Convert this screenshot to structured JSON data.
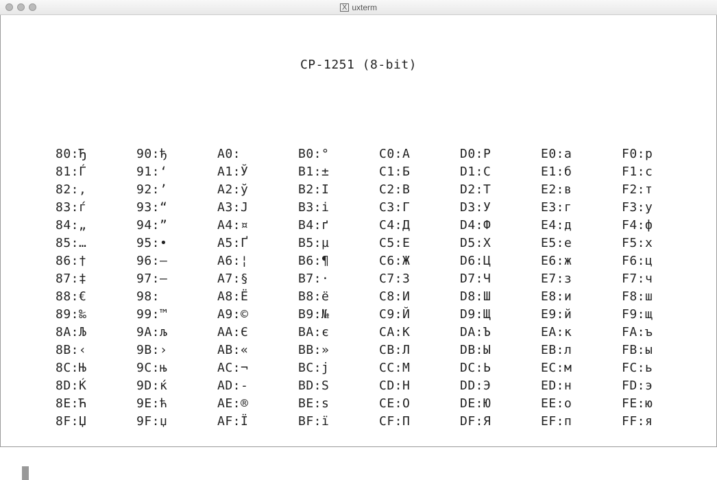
{
  "window": {
    "title": "uxterm"
  },
  "terminal": {
    "title": "CP-1251 (8-bit)",
    "columns": [
      {
        "start": "80",
        "entries": [
          {
            "code": "80",
            "char": "Ђ"
          },
          {
            "code": "81",
            "char": "Ѓ"
          },
          {
            "code": "82",
            "char": "‚"
          },
          {
            "code": "83",
            "char": "ѓ"
          },
          {
            "code": "84",
            "char": "„"
          },
          {
            "code": "85",
            "char": "…"
          },
          {
            "code": "86",
            "char": "†"
          },
          {
            "code": "87",
            "char": "‡"
          },
          {
            "code": "88",
            "char": "€"
          },
          {
            "code": "89",
            "char": "‰"
          },
          {
            "code": "8A",
            "char": "Љ"
          },
          {
            "code": "8B",
            "char": "‹"
          },
          {
            "code": "8C",
            "char": "Њ"
          },
          {
            "code": "8D",
            "char": "Ќ"
          },
          {
            "code": "8E",
            "char": "Ћ"
          },
          {
            "code": "8F",
            "char": "Џ"
          }
        ]
      },
      {
        "start": "90",
        "entries": [
          {
            "code": "90",
            "char": "ђ"
          },
          {
            "code": "91",
            "char": "‘"
          },
          {
            "code": "92",
            "char": "’"
          },
          {
            "code": "93",
            "char": "“"
          },
          {
            "code": "94",
            "char": "”"
          },
          {
            "code": "95",
            "char": "•"
          },
          {
            "code": "96",
            "char": "–"
          },
          {
            "code": "97",
            "char": "—"
          },
          {
            "code": "98",
            "char": " "
          },
          {
            "code": "99",
            "char": "™"
          },
          {
            "code": "9A",
            "char": "љ"
          },
          {
            "code": "9B",
            "char": "›"
          },
          {
            "code": "9C",
            "char": "њ"
          },
          {
            "code": "9D",
            "char": "ќ"
          },
          {
            "code": "9E",
            "char": "ћ"
          },
          {
            "code": "9F",
            "char": "џ"
          }
        ]
      },
      {
        "start": "A0",
        "entries": [
          {
            "code": "A0",
            "char": " "
          },
          {
            "code": "A1",
            "char": "Ў"
          },
          {
            "code": "A2",
            "char": "ў"
          },
          {
            "code": "A3",
            "char": "Ј"
          },
          {
            "code": "A4",
            "char": "¤"
          },
          {
            "code": "A5",
            "char": "Ґ"
          },
          {
            "code": "A6",
            "char": "¦"
          },
          {
            "code": "A7",
            "char": "§"
          },
          {
            "code": "A8",
            "char": "Ё"
          },
          {
            "code": "A9",
            "char": "©"
          },
          {
            "code": "AA",
            "char": "Є"
          },
          {
            "code": "AB",
            "char": "«"
          },
          {
            "code": "AC",
            "char": "¬"
          },
          {
            "code": "AD",
            "char": "-"
          },
          {
            "code": "AE",
            "char": "®"
          },
          {
            "code": "AF",
            "char": "Ї"
          }
        ]
      },
      {
        "start": "B0",
        "entries": [
          {
            "code": "B0",
            "char": "°"
          },
          {
            "code": "B1",
            "char": "±"
          },
          {
            "code": "B2",
            "char": "І"
          },
          {
            "code": "B3",
            "char": "і"
          },
          {
            "code": "B4",
            "char": "ґ"
          },
          {
            "code": "B5",
            "char": "µ"
          },
          {
            "code": "B6",
            "char": "¶"
          },
          {
            "code": "B7",
            "char": "·"
          },
          {
            "code": "B8",
            "char": "ё"
          },
          {
            "code": "B9",
            "char": "№"
          },
          {
            "code": "BA",
            "char": "є"
          },
          {
            "code": "BB",
            "char": "»"
          },
          {
            "code": "BC",
            "char": "ј"
          },
          {
            "code": "BD",
            "char": "Ѕ"
          },
          {
            "code": "BE",
            "char": "ѕ"
          },
          {
            "code": "BF",
            "char": "ї"
          }
        ]
      },
      {
        "start": "C0",
        "entries": [
          {
            "code": "C0",
            "char": "А"
          },
          {
            "code": "C1",
            "char": "Б"
          },
          {
            "code": "C2",
            "char": "В"
          },
          {
            "code": "C3",
            "char": "Г"
          },
          {
            "code": "C4",
            "char": "Д"
          },
          {
            "code": "C5",
            "char": "Е"
          },
          {
            "code": "C6",
            "char": "Ж"
          },
          {
            "code": "C7",
            "char": "З"
          },
          {
            "code": "C8",
            "char": "И"
          },
          {
            "code": "C9",
            "char": "Й"
          },
          {
            "code": "CA",
            "char": "К"
          },
          {
            "code": "CB",
            "char": "Л"
          },
          {
            "code": "CC",
            "char": "М"
          },
          {
            "code": "CD",
            "char": "Н"
          },
          {
            "code": "CE",
            "char": "О"
          },
          {
            "code": "CF",
            "char": "П"
          }
        ]
      },
      {
        "start": "D0",
        "entries": [
          {
            "code": "D0",
            "char": "Р"
          },
          {
            "code": "D1",
            "char": "С"
          },
          {
            "code": "D2",
            "char": "Т"
          },
          {
            "code": "D3",
            "char": "У"
          },
          {
            "code": "D4",
            "char": "Ф"
          },
          {
            "code": "D5",
            "char": "Х"
          },
          {
            "code": "D6",
            "char": "Ц"
          },
          {
            "code": "D7",
            "char": "Ч"
          },
          {
            "code": "D8",
            "char": "Ш"
          },
          {
            "code": "D9",
            "char": "Щ"
          },
          {
            "code": "DA",
            "char": "Ъ"
          },
          {
            "code": "DB",
            "char": "Ы"
          },
          {
            "code": "DC",
            "char": "Ь"
          },
          {
            "code": "DD",
            "char": "Э"
          },
          {
            "code": "DE",
            "char": "Ю"
          },
          {
            "code": "DF",
            "char": "Я"
          }
        ]
      },
      {
        "start": "E0",
        "entries": [
          {
            "code": "E0",
            "char": "а"
          },
          {
            "code": "E1",
            "char": "б"
          },
          {
            "code": "E2",
            "char": "в"
          },
          {
            "code": "E3",
            "char": "г"
          },
          {
            "code": "E4",
            "char": "д"
          },
          {
            "code": "E5",
            "char": "е"
          },
          {
            "code": "E6",
            "char": "ж"
          },
          {
            "code": "E7",
            "char": "з"
          },
          {
            "code": "E8",
            "char": "и"
          },
          {
            "code": "E9",
            "char": "й"
          },
          {
            "code": "EA",
            "char": "к"
          },
          {
            "code": "EB",
            "char": "л"
          },
          {
            "code": "EC",
            "char": "м"
          },
          {
            "code": "ED",
            "char": "н"
          },
          {
            "code": "EE",
            "char": "о"
          },
          {
            "code": "EF",
            "char": "п"
          }
        ]
      },
      {
        "start": "F0",
        "entries": [
          {
            "code": "F0",
            "char": "р"
          },
          {
            "code": "F1",
            "char": "с"
          },
          {
            "code": "F2",
            "char": "т"
          },
          {
            "code": "F3",
            "char": "у"
          },
          {
            "code": "F4",
            "char": "ф"
          },
          {
            "code": "F5",
            "char": "х"
          },
          {
            "code": "F6",
            "char": "ц"
          },
          {
            "code": "F7",
            "char": "ч"
          },
          {
            "code": "F8",
            "char": "ш"
          },
          {
            "code": "F9",
            "char": "щ"
          },
          {
            "code": "FA",
            "char": "ъ"
          },
          {
            "code": "FB",
            "char": "ы"
          },
          {
            "code": "FC",
            "char": "ь"
          },
          {
            "code": "FD",
            "char": "э"
          },
          {
            "code": "FE",
            "char": "ю"
          },
          {
            "code": "FF",
            "char": "я"
          }
        ]
      }
    ]
  }
}
